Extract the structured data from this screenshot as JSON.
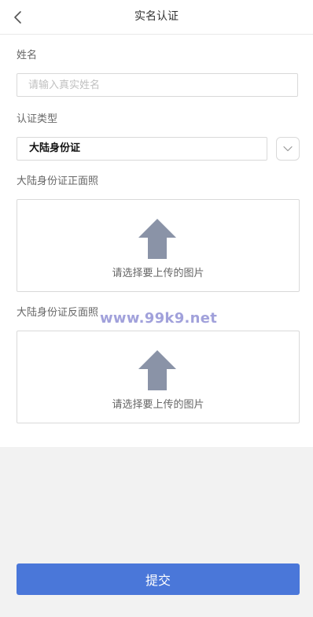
{
  "header": {
    "title": "实名认证",
    "back_icon": "chevron-left-icon"
  },
  "form": {
    "name": {
      "label": "姓名",
      "placeholder": "请输入真实姓名",
      "value": ""
    },
    "id_type": {
      "label": "认证类型",
      "selected": "大陆身份证",
      "dropdown_icon": "chevron-down-icon"
    },
    "front_photo": {
      "label": "大陆身份证正面照",
      "upload_text": "请选择要上传的图片",
      "icon": "upload-arrow-icon"
    },
    "back_photo": {
      "label": "大陆身份证反面照",
      "upload_text": "请选择要上传的图片",
      "icon": "upload-arrow-icon"
    }
  },
  "watermark": {
    "text": "www.99k9.net"
  },
  "submit": {
    "label": "提交"
  },
  "colors": {
    "accent": "#4a77d9",
    "upload_icon": "#8a93a7",
    "page_background": "#f2f2f2"
  }
}
